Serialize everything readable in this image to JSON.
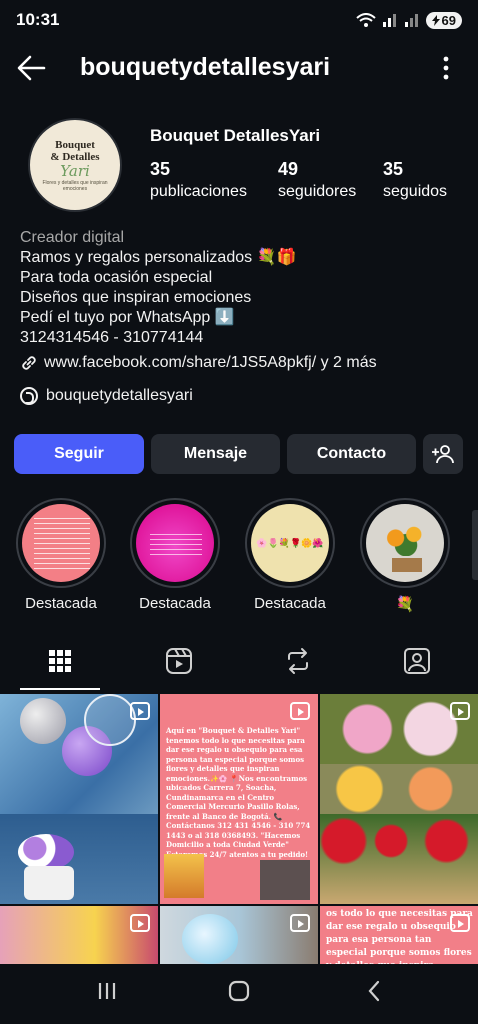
{
  "status": {
    "time": "10:31",
    "battery": "69"
  },
  "header": {
    "username": "bouquetydetallesyari"
  },
  "avatar": {
    "line1": "Bouquet",
    "line2": "& Detalles",
    "line3": "Yari",
    "line4": "Flores y detalles que inspiran emociones"
  },
  "profile": {
    "display_name": "Bouquet DetallesYari",
    "stats": [
      {
        "num": "35",
        "label": "publicaciones"
      },
      {
        "num": "49",
        "label": "seguidores"
      },
      {
        "num": "35",
        "label": "seguidos"
      }
    ]
  },
  "bio": {
    "category": "Creador digital",
    "lines": [
      "Ramos y regalos personalizados 💐🎁",
      "Para toda ocasión especial",
      "Diseños que inspiran emociones",
      "Pedí el tuyo por WhatsApp ⬇️",
      "3124314546 - 310774144"
    ],
    "link": "www.facebook.com/share/1JS5A8pkfj/ y 2 más",
    "threads": "bouquetydetallesyari"
  },
  "actions": {
    "follow": "Seguir",
    "message": "Mensaje",
    "contact": "Contacto"
  },
  "highlights": [
    "Destacada",
    "Destacada",
    "Destacada",
    "💐"
  ],
  "highlight3_text": "🌸🌷💐🌹🌼🌺",
  "posts": {
    "p2": "Aquí en \"Bouquet & Detalles Yari\" tenemos todo lo que necesitas para dar ese regalo u obsequio para esa persona tan especial porque somos flores y detalles que inspiran emociones.✨🌸 📍Nos encontramos ubicados Carrera 7, Soacha, Cundinamarca en el Centro Comercial Mercurio Pasillo Rolas, frente al Banco de Bogotá. 📞Contáctanos 312 431 4546 - 310 774 1443 o al 318 0368493. \"Hacemos Domicilio a toda Ciudad Verde\" Estaremos 24/7 atentos a tu pedido!",
    "p6": "os todo lo que necesitas para dar ese regalo u obsequio para esa persona tan especial porque somos flores y detalles que inspira emociones.✨🌸"
  },
  "colors": {
    "accent": "#4a5df9",
    "background": "#0c0f14",
    "button_secondary": "#262a31"
  }
}
